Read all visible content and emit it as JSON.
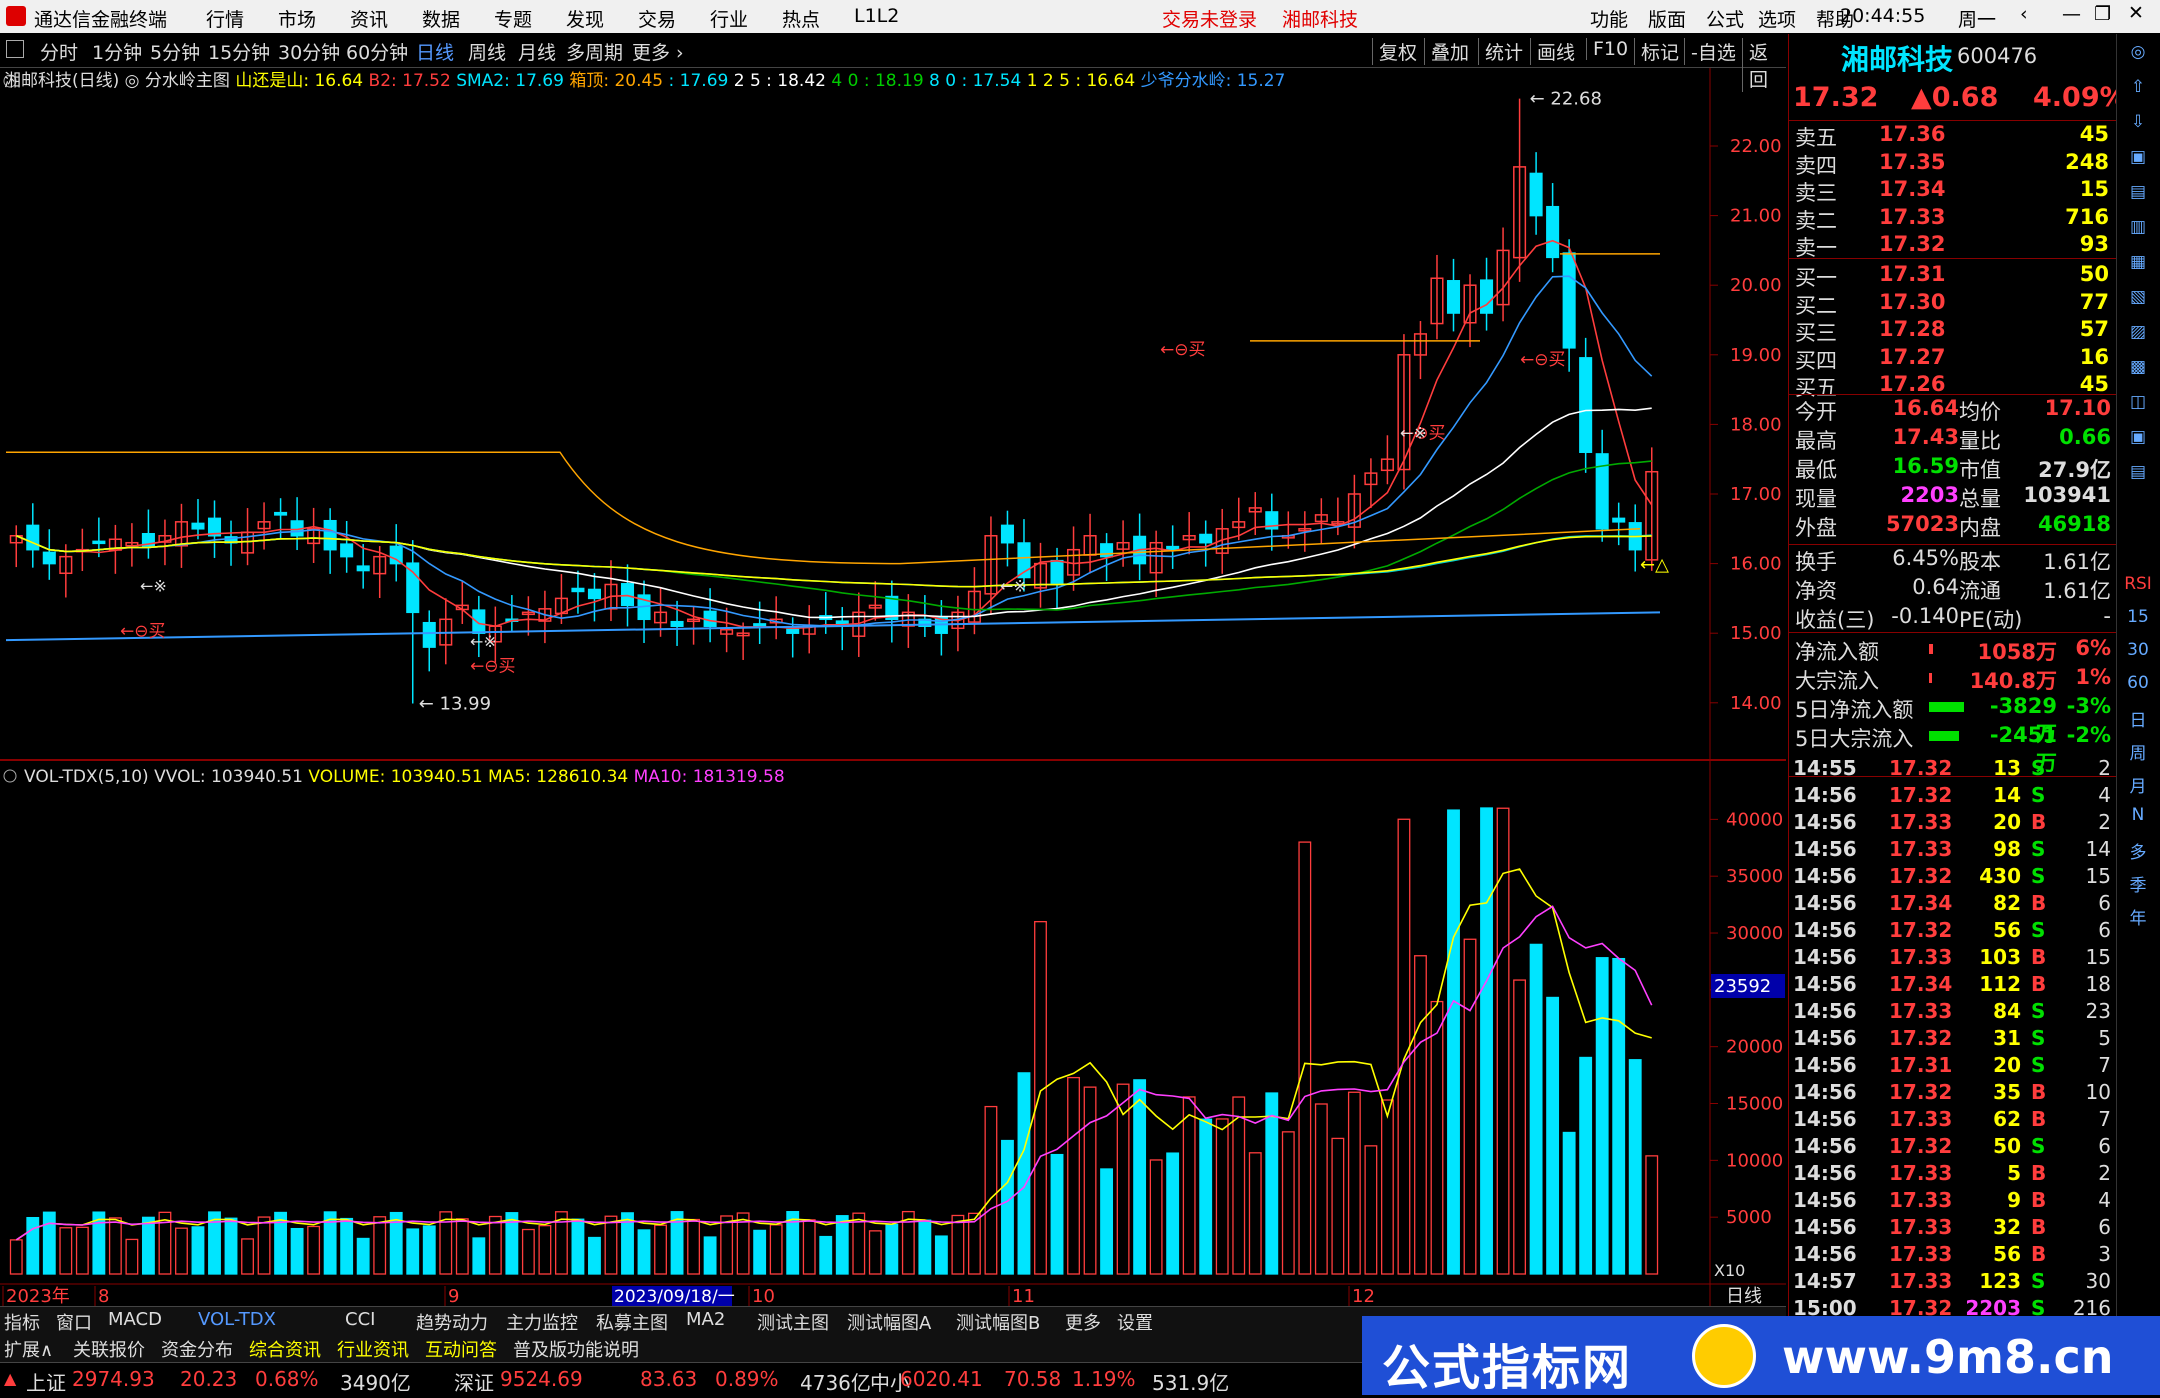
{
  "titlebar": {
    "app_name": "通达信金融终端",
    "menu": [
      "行情",
      "市场",
      "资讯",
      "数据",
      "专题",
      "发现",
      "交易",
      "行业",
      "热点",
      "L1L2"
    ],
    "status_login": "交易未登录",
    "status_stock": "湘邮科技",
    "right_menu": [
      "功能",
      "版面",
      "公式",
      "选项",
      "帮助"
    ],
    "time": "20:44:55",
    "weekday": "周一"
  },
  "periods": {
    "items": [
      "分时",
      "1分钟",
      "5分钟",
      "15分钟",
      "30分钟",
      "60分钟",
      "日线",
      "周线",
      "月线",
      "多周期",
      "更多"
    ],
    "active": "日线"
  },
  "toolbtns": [
    "复权",
    "叠加",
    "统计",
    "画线",
    "F10",
    "标记",
    "-自选",
    "返回"
  ],
  "main_legend": {
    "name": "湘邮科技(日线)",
    "formula": "分水岭主图",
    "items": [
      {
        "label": "山还是山: ",
        "value": "16.64",
        "color": "#ffff00"
      },
      {
        "label": "B2: ",
        "value": "17.52",
        "color": "#ff3d3d"
      },
      {
        "label": "SMA2: ",
        "value": "17.69",
        "color": "#00e5ff"
      },
      {
        "label": "箱顶: ",
        "value": "20.45 ",
        "color": "#ffa500"
      },
      {
        "label": ": ",
        "value": "17.69",
        "color": "#00e5ff"
      },
      {
        "label": "2 5 : ",
        "value": "18.42",
        "color": "#ffffff"
      },
      {
        "label": "4 0 : ",
        "value": "18.19",
        "color": "#00cc00"
      },
      {
        "label": "8 0 : ",
        "value": "17.54",
        "color": "#00e5ff"
      },
      {
        "label": "1 2 5 : ",
        "value": "16.64",
        "color": "#ffff00"
      },
      {
        "label": "少爷分水岭: ",
        "value": "15.27",
        "color": "#3399ff"
      }
    ]
  },
  "price_axis": [
    "22.00",
    "21.00",
    "20.00",
    "19.00",
    "18.00",
    "17.00",
    "16.00",
    "15.00",
    "14.00"
  ],
  "annotations": {
    "high": "22.68",
    "low": "13.99",
    "buy": "买",
    "star": "※"
  },
  "vol_legend": {
    "name": "VOL-TDX(5,10)",
    "vvol": "VVOL: 103940.51",
    "volume": "VOLUME: 103940.51",
    "ma5": "MA5: 128610.34",
    "ma10": "MA10: 181319.58"
  },
  "vol_axis": [
    "40000",
    "35000",
    "30000",
    "25000",
    "20000",
    "15000",
    "10000",
    "5000"
  ],
  "vol_cursor": "23592",
  "vol_unit": "X10",
  "date_axis": {
    "labels": [
      "2023年",
      "8",
      "9",
      "10",
      "11",
      "12"
    ],
    "cursor_date": "2023/09/18/一",
    "period": "日线"
  },
  "chart_data": {
    "type": "candlestick",
    "x": [
      "2023/07",
      "2023/08",
      "2023/09",
      "2023/10",
      "2023/11",
      "2023/12"
    ],
    "ohlc_sample": {
      "high": 22.68,
      "low": 13.99,
      "last": 17.32
    },
    "volume_max": 41000
  },
  "bottom_tabs": [
    "指标",
    "窗口",
    "MACD",
    "VOL-TDX",
    "CCI",
    "趋势动力",
    "主力监控",
    "私募主图",
    "MA2",
    "测试主图",
    "测试幅图A",
    "测试幅图B",
    "更多",
    "设置"
  ],
  "bottom_tabs2": [
    "扩展∧",
    "关联报价",
    "资金分布",
    "综合资讯",
    "行业资讯",
    "互动问答",
    "普及版功能说明"
  ],
  "status": [
    {
      "name": "上证",
      "price": "2974.93",
      "chg": "20.23",
      "pct": "0.68%",
      "amt": "3490亿"
    },
    {
      "name": "深证",
      "price": "9524.69",
      "chg": "83.63",
      "pct": "0.89%",
      "amt": "4736亿"
    },
    {
      "name": "中小",
      "price": "6020.41",
      "chg": "70.58",
      "pct": "1.19%",
      "amt": "531.9亿"
    }
  ],
  "quote": {
    "name": "湘邮科技",
    "code": "600476",
    "price": "17.32",
    "change": "▲0.68",
    "pct": "4.09%",
    "asks": [
      {
        "label": "卖五",
        "price": "17.36",
        "vol": "45"
      },
      {
        "label": "卖四",
        "price": "17.35",
        "vol": "248"
      },
      {
        "label": "卖三",
        "price": "17.34",
        "vol": "15"
      },
      {
        "label": "卖二",
        "price": "17.33",
        "vol": "716"
      },
      {
        "label": "卖一",
        "price": "17.32",
        "vol": "93"
      }
    ],
    "bids": [
      {
        "label": "买一",
        "price": "17.31",
        "vol": "50"
      },
      {
        "label": "买二",
        "price": "17.30",
        "vol": "77"
      },
      {
        "label": "买三",
        "price": "17.28",
        "vol": "57"
      },
      {
        "label": "买四",
        "price": "17.27",
        "vol": "16"
      },
      {
        "label": "买五",
        "price": "17.26",
        "vol": "45"
      }
    ],
    "stats": [
      {
        "l1": "今开",
        "v1": "16.64",
        "c1": "#ff3d3d",
        "l2": "均价",
        "v2": "17.10",
        "c2": "#ff3d3d"
      },
      {
        "l1": "最高",
        "v1": "17.43",
        "c1": "#ff3d3d",
        "l2": "量比",
        "v2": "0.66",
        "c2": "#00e000"
      },
      {
        "l1": "最低",
        "v1": "16.59",
        "c1": "#00e000",
        "l2": "市值",
        "v2": "27.9亿",
        "c2": "#ddd"
      },
      {
        "l1": "现量",
        "v1": "2203",
        "c1": "#ff40ff",
        "l2": "总量",
        "v2": "103941",
        "c2": "#ddd"
      },
      {
        "l1": "外盘",
        "v1": "57023",
        "c1": "#ff3d3d",
        "l2": "内盘",
        "v2": "46918",
        "c2": "#00e000"
      }
    ],
    "stats2": [
      {
        "l1": "换手",
        "v1": "6.45%",
        "l2": "股本",
        "v2": "1.61亿"
      },
      {
        "l1": "净资",
        "v1": "0.64",
        "l2": "流通",
        "v2": "1.61亿"
      },
      {
        "l1": "收益(三)",
        "v1": "-0.140",
        "l2": "PE(动)",
        "v2": "-"
      }
    ],
    "flows": [
      {
        "label": "净流入额",
        "val": "1058万",
        "pct": "6%",
        "color": "#ff3d3d",
        "bar": 0.08
      },
      {
        "label": "大宗流入",
        "val": "140.8万",
        "pct": "1%",
        "color": "#ff3d3d",
        "bar": 0.01
      },
      {
        "label": "5日净流入额",
        "val": "-3829万",
        "pct": "-3%",
        "color": "#00e000",
        "bar": 0.7
      },
      {
        "label": "5日大宗流入",
        "val": "-2451万",
        "pct": "-2%",
        "color": "#00e000",
        "bar": 0.6
      }
    ],
    "ticks": [
      {
        "t": "14:55",
        "p": "17.32",
        "v": "13",
        "s": "S",
        "n": "2"
      },
      {
        "t": "14:56",
        "p": "17.32",
        "v": "14",
        "s": "S",
        "n": "4"
      },
      {
        "t": "14:56",
        "p": "17.33",
        "v": "20",
        "s": "B",
        "n": "2"
      },
      {
        "t": "14:56",
        "p": "17.33",
        "v": "98",
        "s": "S",
        "n": "14"
      },
      {
        "t": "14:56",
        "p": "17.32",
        "v": "430",
        "s": "S",
        "n": "15"
      },
      {
        "t": "14:56",
        "p": "17.34",
        "v": "82",
        "s": "B",
        "n": "6"
      },
      {
        "t": "14:56",
        "p": "17.32",
        "v": "56",
        "s": "S",
        "n": "6"
      },
      {
        "t": "14:56",
        "p": "17.33",
        "v": "103",
        "s": "B",
        "n": "15"
      },
      {
        "t": "14:56",
        "p": "17.34",
        "v": "112",
        "s": "B",
        "n": "18"
      },
      {
        "t": "14:56",
        "p": "17.33",
        "v": "84",
        "s": "S",
        "n": "23"
      },
      {
        "t": "14:56",
        "p": "17.32",
        "v": "31",
        "s": "S",
        "n": "5"
      },
      {
        "t": "14:56",
        "p": "17.31",
        "v": "20",
        "s": "S",
        "n": "7"
      },
      {
        "t": "14:56",
        "p": "17.32",
        "v": "35",
        "s": "B",
        "n": "10"
      },
      {
        "t": "14:56",
        "p": "17.33",
        "v": "62",
        "s": "B",
        "n": "7"
      },
      {
        "t": "14:56",
        "p": "17.32",
        "v": "50",
        "s": "S",
        "n": "6"
      },
      {
        "t": "14:56",
        "p": "17.33",
        "v": "5",
        "s": "B",
        "n": "2"
      },
      {
        "t": "14:56",
        "p": "17.33",
        "v": "9",
        "s": "B",
        "n": "4"
      },
      {
        "t": "14:56",
        "p": "17.33",
        "v": "32",
        "s": "B",
        "n": "6"
      },
      {
        "t": "14:56",
        "p": "17.33",
        "v": "56",
        "s": "B",
        "n": "3"
      },
      {
        "t": "14:57",
        "p": "17.33",
        "v": "123",
        "s": "S",
        "n": "30"
      },
      {
        "t": "15:00",
        "p": "17.32",
        "v": "2203",
        "s": "S",
        "n": "216"
      }
    ]
  },
  "sidetools": [
    "RSI",
    "15",
    "30",
    "60",
    "日",
    "周",
    "月",
    "N",
    "多",
    "季",
    "年"
  ],
  "watermark": {
    "text": "公式指标网",
    "url": "www.9m8.cn"
  }
}
